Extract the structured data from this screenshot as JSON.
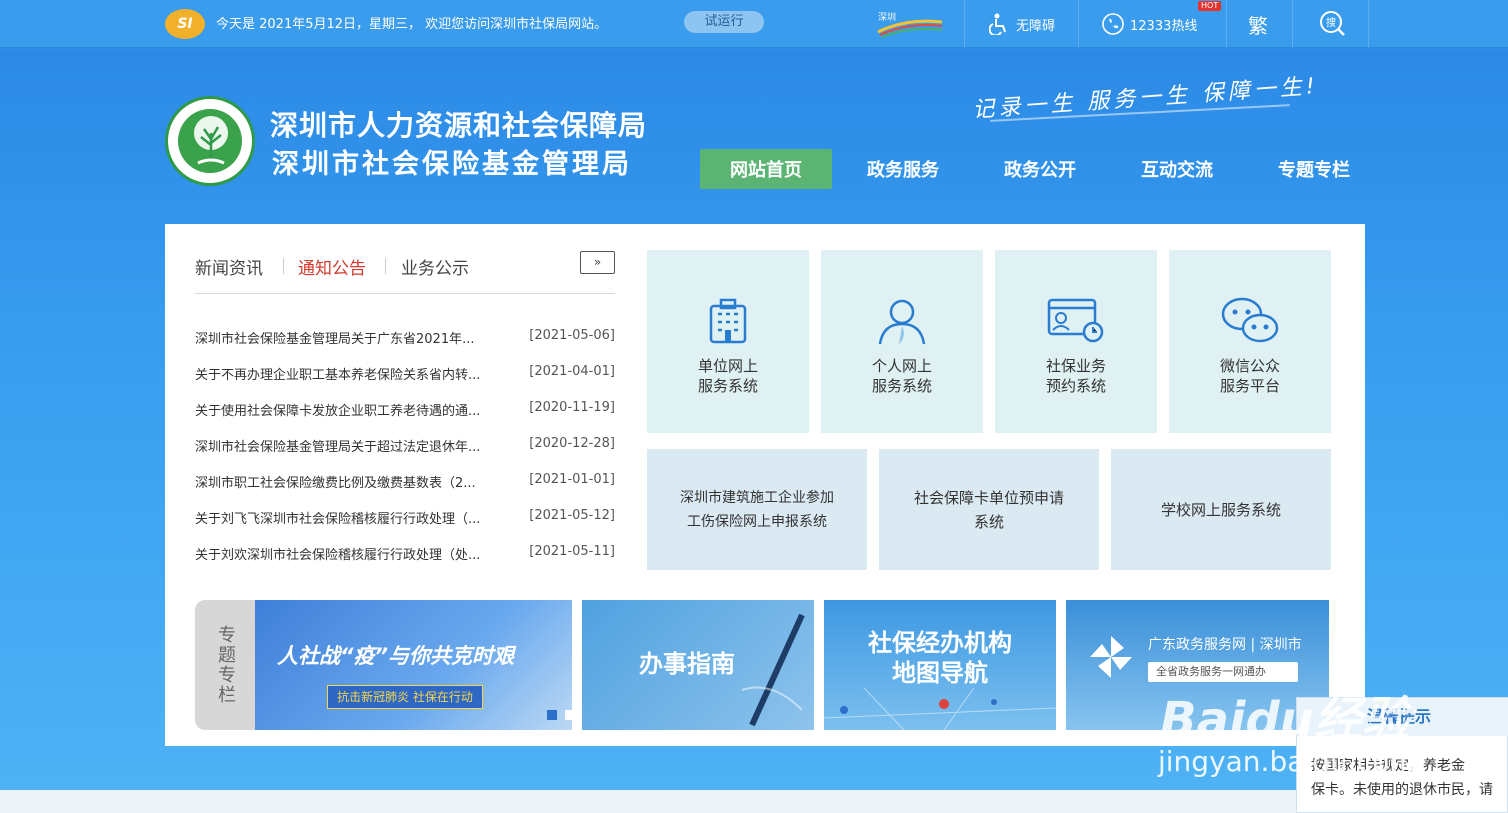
{
  "topbar": {
    "logo_text": "SI",
    "greeting": "今天是 2021年5月12日，星期三， 欢迎您访问深圳市社保局网站。",
    "trial_label": "试运行",
    "accessibility_label": "无障碍",
    "hotline_label": "12333热线",
    "hot_badge": "HOT",
    "traditional_label": "繁",
    "search_label": "搜"
  },
  "header": {
    "title_line1": "深圳市人力资源和社会保障局",
    "title_line2": "深圳市社会保险基金管理局",
    "slogan": "记录一生 服务一生 保障一生!"
  },
  "nav": [
    {
      "label": "网站首页",
      "active": true
    },
    {
      "label": "政务服务",
      "active": false
    },
    {
      "label": "政务公开",
      "active": false
    },
    {
      "label": "互动交流",
      "active": false
    },
    {
      "label": "专题专栏",
      "active": false
    }
  ],
  "news": {
    "tabs": [
      "新闻资讯",
      "通知公告",
      "业务公示"
    ],
    "active_tab": 1,
    "more_label": "»",
    "items": [
      {
        "title": "深圳市社会保险基金管理局关于广东省2021年...",
        "date": "[2021-05-06]"
      },
      {
        "title": "关于不再办理企业职工基本养老保险关系省内转...",
        "date": "[2021-04-01]"
      },
      {
        "title": "关于使用社会保障卡发放企业职工养老待遇的通...",
        "date": "[2020-11-19]"
      },
      {
        "title": "深圳市社会保险基金管理局关于超过法定退休年...",
        "date": "[2020-12-28]"
      },
      {
        "title": "深圳市职工社会保险缴费比例及缴费基数表（2...",
        "date": "[2021-01-01]"
      },
      {
        "title": "关于刘飞飞深圳市社会保险稽核履行行政处理（...",
        "date": "[2021-05-12]"
      },
      {
        "title": "关于刘欢深圳市社会保险稽核履行行政处理（处...",
        "date": "[2021-05-11]"
      }
    ]
  },
  "services": [
    {
      "line1": "单位网上",
      "line2": "服务系统",
      "icon": "building-icon"
    },
    {
      "line1": "个人网上",
      "line2": "服务系统",
      "icon": "person-icon"
    },
    {
      "line1": "社保业务",
      "line2": "预约系统",
      "icon": "appointment-icon"
    },
    {
      "line1": "微信公众",
      "line2": "服务平台",
      "icon": "wechat-icon"
    }
  ],
  "services2": [
    {
      "line1": "深圳市建筑施工企业参加",
      "line2": "工伤保险网上申报系统"
    },
    {
      "line1": "社会保障卡单位预申请",
      "line2": "系统"
    },
    {
      "line1": "学校网上服务系统",
      "line2": ""
    }
  ],
  "special": {
    "label": "专题专栏",
    "banner1_title": "人社战“疫”与你共克时艰",
    "banner1_sub": "抗击新冠肺炎 社保在行动",
    "banner2_title": "办事指南",
    "banner3_line1": "社保经办机构",
    "banner3_line2": "地图导航",
    "banner4_title": "广东政务服务网 | 深圳市",
    "banner4_sub": "全省政务服务一网通办"
  },
  "overlay": {
    "watermark": "Baidu经验",
    "url": "jingyan.baidu.com",
    "popup_title": "温馨提示",
    "popup_line1": "按国家相关规定，养老金",
    "popup_line2": "保卡。未使用的退休市民，请"
  },
  "colors": {
    "accent_green": "#5cb473",
    "active_tab_red": "#d33a2c",
    "bg_blue": "#2f8fe8"
  }
}
